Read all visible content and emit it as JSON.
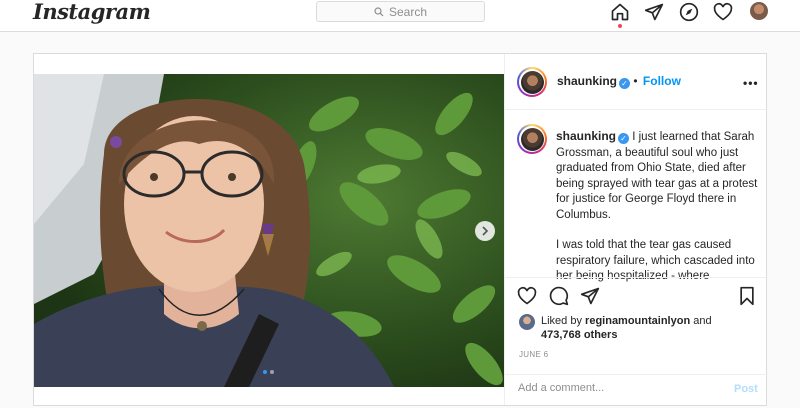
{
  "nav": {
    "logo": "Instagram",
    "search_placeholder": "Search",
    "icons": [
      "home-icon",
      "direct-icon",
      "explore-icon",
      "activity-icon",
      "profile-avatar"
    ]
  },
  "post": {
    "author": "shaunking",
    "follow_label": "Follow",
    "more_label": "•••",
    "caption": [
      "I just learned that Sarah Grossman, a beautiful soul who just graduated from Ohio State, died after being sprayed with tear gas at a protest for justice for George Floyd there in Columbus.",
      "I was told that the tear gas caused respiratory failure, which cascaded into her being hospitalized - where"
    ],
    "liked_by_prefix": "Liked by",
    "liked_by_user": "reginamountainlyon",
    "liked_by_and": "and",
    "others_count": "473,768 others",
    "date": "JUNE 6",
    "comment_placeholder": "Add a comment...",
    "post_label": "Post",
    "carousel": {
      "total": 2,
      "active": 1
    }
  },
  "colors": {
    "accent": "#0095f6",
    "verified": "#3897f0",
    "notification": "#ed4956",
    "border": "#dbdbdb"
  }
}
